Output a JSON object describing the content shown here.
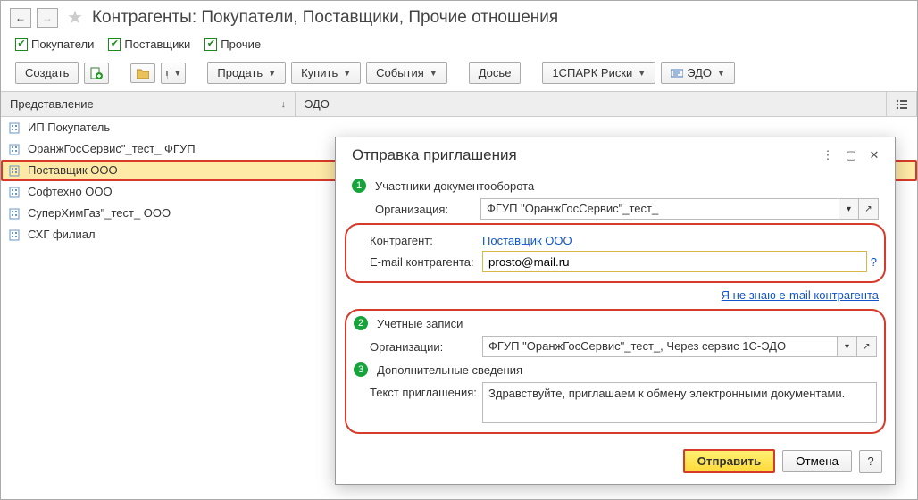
{
  "header": {
    "title": "Контрагенты: Покупатели, Поставщики, Прочие отношения"
  },
  "filters": {
    "buyers": "Покупатели",
    "suppliers": "Поставщики",
    "others": "Прочие"
  },
  "toolbar": {
    "create": "Создать",
    "sell": "Продать",
    "buy": "Купить",
    "events": "События",
    "dossier": "Досье",
    "spark": "1СПАРК Риски",
    "edo": "ЭДО"
  },
  "table": {
    "columns": {
      "representation": "Представление",
      "edo": "ЭДО"
    },
    "rows": [
      {
        "name": "ИП Покупатель"
      },
      {
        "name": "ОранжГосСервис\"_тест_ ФГУП"
      },
      {
        "name": "Поставщик ООО",
        "selected": true,
        "highlight": true,
        "edoicon": true
      },
      {
        "name": "Софтехно ООО",
        "edoicon": true
      },
      {
        "name": "СуперХимГаз\"_тест_ ООО"
      },
      {
        "name": "СХГ филиал"
      }
    ]
  },
  "dialog": {
    "title": "Отправка приглашения",
    "step1": "Участники документооборота",
    "org_label": "Организация:",
    "org_value": "ФГУП \"ОранжГосСервис\"_тест_",
    "counterparty_label": "Контрагент:",
    "counterparty_value": "Поставщик ООО",
    "email_label": "E-mail контрагента:",
    "email_value": "prosto@mail.ru",
    "no_email_link": "Я не знаю e-mail контрагента",
    "step2": "Учетные записи",
    "org2_label": "Организации:",
    "org2_value": "ФГУП \"ОранжГосСервис\"_тест_, Через сервис 1С-ЭДО",
    "step3": "Дополнительные сведения",
    "invite_text_label": "Текст приглашения:",
    "invite_text_value": "Здравствуйте, приглашаем к обмену электронными документами.",
    "send": "Отправить",
    "cancel": "Отмена"
  }
}
